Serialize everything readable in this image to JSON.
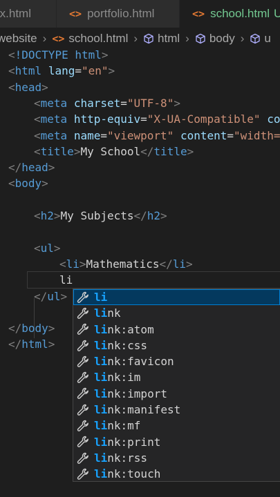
{
  "tabs": [
    {
      "icon": "",
      "label": "x.html"
    },
    {
      "icon": "<>",
      "label": "portfolio.html"
    },
    {
      "icon": "<>",
      "label": "school.html",
      "status": "U"
    }
  ],
  "breadcrumb": {
    "folder": "website",
    "file": "school.html",
    "html": "html",
    "body": "body",
    "next": "u"
  },
  "code": {
    "doctype": "<!DOCTYPE html>",
    "html_open": {
      "tag": "html",
      "attr": "lang",
      "value": "\"en\""
    },
    "head": "head",
    "meta1": {
      "tag": "meta",
      "attr": "charset",
      "value": "\"UTF-8\""
    },
    "meta2": {
      "tag": "meta",
      "attr": "http-equiv",
      "value": "\"X-UA-Compatible\"",
      "attr2": "cont"
    },
    "meta3": {
      "tag": "meta",
      "attr": "name",
      "value": "\"viewport\"",
      "attr2": "content",
      "value2": "\"width=de"
    },
    "title": {
      "tag": "title",
      "text": "My School"
    },
    "body": "body",
    "h2": {
      "tag": "h2",
      "text": "My Subjects"
    },
    "ul": "ul",
    "li": {
      "tag": "li",
      "text": "Mathematics"
    },
    "typed": "li",
    "html_close": "html"
  },
  "suggestions": {
    "match": "li",
    "items": [
      {
        "label": "li",
        "selected": true
      },
      {
        "label": "link"
      },
      {
        "label": "link:atom"
      },
      {
        "label": "link:css"
      },
      {
        "label": "link:favicon"
      },
      {
        "label": "link:im"
      },
      {
        "label": "link:import"
      },
      {
        "label": "link:manifest"
      },
      {
        "label": "link:mf"
      },
      {
        "label": "link:print"
      },
      {
        "label": "link:rss"
      },
      {
        "label": "link:touch"
      }
    ]
  },
  "colors": {
    "background": "#1e1e1e",
    "tag": "#569cd6",
    "attribute": "#9cdcfe",
    "string": "#ce9178",
    "untracked": "#73c991",
    "match_highlight": "#18a3ff",
    "selection": "#04395e"
  }
}
